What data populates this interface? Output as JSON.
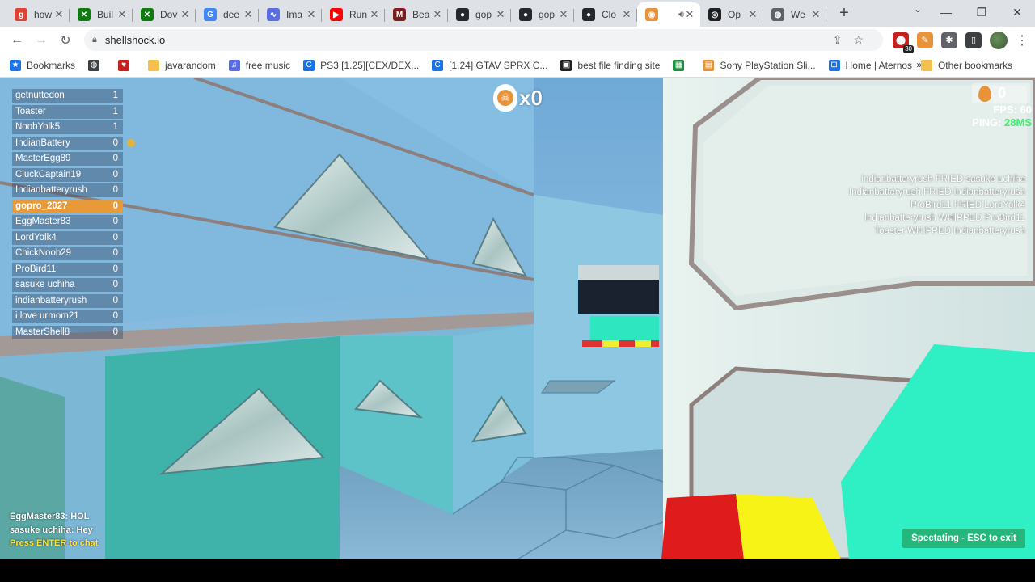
{
  "browser": {
    "tabs": [
      {
        "title": "how",
        "color": "#db4437",
        "glyph": "g"
      },
      {
        "title": "Buil",
        "color": "#0f7a0f",
        "glyph": "✕"
      },
      {
        "title": "Dov",
        "color": "#0f7a0f",
        "glyph": "✕"
      },
      {
        "title": "dee",
        "color": "#4285f4",
        "glyph": "G"
      },
      {
        "title": "Ima",
        "color": "#5b6ee1",
        "glyph": "∿"
      },
      {
        "title": "Run",
        "color": "#ff0000",
        "glyph": "▶"
      },
      {
        "title": "Bea",
        "color": "#7a1d1d",
        "glyph": "M"
      },
      {
        "title": "gop",
        "color": "#24292f",
        "glyph": "●"
      },
      {
        "title": "gop",
        "color": "#24292f",
        "glyph": "●"
      },
      {
        "title": "Clo",
        "color": "#24292f",
        "glyph": "●"
      },
      {
        "title": "",
        "color": "#e8923a",
        "glyph": "◉",
        "active": true
      },
      {
        "title": "Op",
        "color": "#202124",
        "glyph": "◎"
      },
      {
        "title": "We",
        "color": "#5f6368",
        "glyph": "◍"
      }
    ],
    "new_tab": "+",
    "window_controls": {
      "minimize": "—",
      "maximize": "❐",
      "close": "✕"
    },
    "tab_search": "⌄",
    "nav": {
      "back": "←",
      "forward": "→",
      "reload": "↻"
    },
    "url": "shellshock.io",
    "omni_icons": "⇪☆",
    "extensions": [
      {
        "glyph": "⬤",
        "color": "#c5221f",
        "badge": "30"
      },
      {
        "glyph": "✎",
        "color": "#e8923a",
        "badge": ""
      },
      {
        "glyph": "✱",
        "color": "#5f6368",
        "badge": ""
      },
      {
        "glyph": "▯",
        "color": "#3c4043",
        "badge": ""
      }
    ],
    "menu": "⋮"
  },
  "bookmarks": {
    "items": [
      {
        "label": "Bookmarks",
        "color": "#1a73e8",
        "glyph": "★"
      },
      {
        "label": "",
        "color": "#3c4043",
        "glyph": "◍"
      },
      {
        "label": "",
        "color": "#c5221f",
        "glyph": "♥"
      },
      {
        "label": "javarandom",
        "color": "#f2c14e",
        "glyph": ""
      },
      {
        "label": "free music",
        "color": "#5b6ee1",
        "glyph": "♫"
      },
      {
        "label": "PS3 [1.25][CEX/DEX...",
        "color": "#1a73e8",
        "glyph": "C"
      },
      {
        "label": "[1.24] GTAV SPRX C...",
        "color": "#1a73e8",
        "glyph": "C"
      },
      {
        "label": "best file finding site",
        "color": "#202124",
        "glyph": "▣"
      },
      {
        "label": "",
        "color": "#1e8e3e",
        "glyph": "▦"
      },
      {
        "label": "Sony PlayStation Sli...",
        "color": "#e8923a",
        "glyph": "▤"
      },
      {
        "label": "Home | Aternos",
        "color": "#1a73e8",
        "glyph": "⊡"
      }
    ],
    "more": "»",
    "other": "Other bookmarks"
  },
  "game": {
    "scoreboard": [
      {
        "name": "getnuttedon",
        "score": "1"
      },
      {
        "name": "Toaster",
        "score": "1"
      },
      {
        "name": "NoobYolk5",
        "score": "1"
      },
      {
        "name": "IndianBattery",
        "score": "0",
        "medal": true
      },
      {
        "name": "MasterEgg89",
        "score": "0"
      },
      {
        "name": "CluckCaptain19",
        "score": "0"
      },
      {
        "name": "Indianbatteryrush",
        "score": "0"
      },
      {
        "name": "gopro_2027",
        "score": "0",
        "me": true
      },
      {
        "name": "EggMaster83",
        "score": "0"
      },
      {
        "name": "LordYolk4",
        "score": "0"
      },
      {
        "name": "ChickNoob29",
        "score": "0"
      },
      {
        "name": "ProBird11",
        "score": "0"
      },
      {
        "name": "sasuke uchiha",
        "score": "0"
      },
      {
        "name": "indianbatteryrush",
        "score": "0"
      },
      {
        "name": "i love urmom21",
        "score": "0"
      },
      {
        "name": "MasterShell8",
        "score": "0"
      }
    ],
    "kills": "x0",
    "eggs": "0",
    "fps_label": "FPS: 60",
    "ping_label": "PING: ",
    "ping_value": "28MS",
    "killfeed": [
      "indianbatteryrush FRIED sasuke uchiha",
      "Indianbatteryrush FRIED indianbatteryrush",
      "ProBird11 FRIED LordYolk4",
      "Indianbatteryrush WHIPPED ProBird11",
      "Toaster WHIPPED Indianbatteryrush"
    ],
    "chat": [
      "EggMaster83: HOL",
      "sasuke uchiha: Hey"
    ],
    "chat_hint": "Press ENTER to chat",
    "spectating": "Spectating - ESC to exit"
  }
}
